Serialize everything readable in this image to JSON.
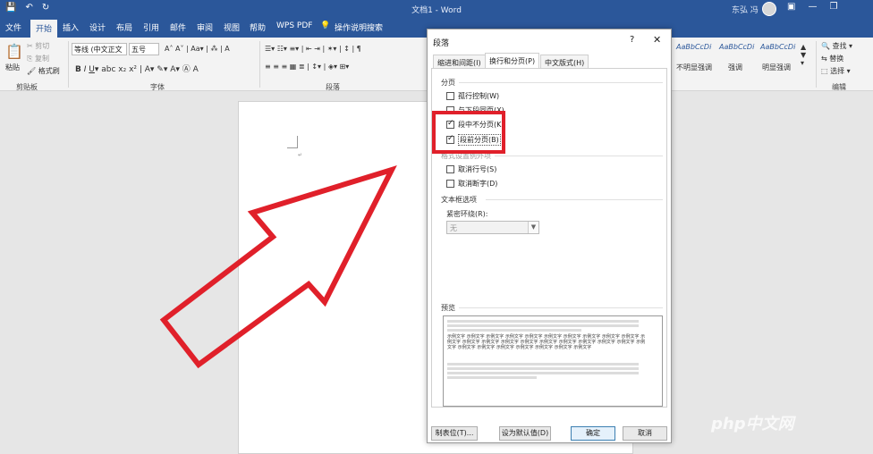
{
  "window": {
    "title": "文档1 - Word",
    "user": "东弘 冯",
    "qat_icons": [
      "save-icon",
      "undo-icon",
      "redo-icon"
    ]
  },
  "menu": {
    "tabs": [
      "文件",
      "开始",
      "插入",
      "设计",
      "布局",
      "引用",
      "邮件",
      "审阅",
      "视图",
      "帮助",
      "WPS PDF"
    ],
    "active": "开始",
    "tell_me": "操作说明搜索"
  },
  "ribbon": {
    "clipboard": {
      "paste": "粘贴",
      "cut": "剪切",
      "copy": "复制",
      "format_painter": "格式刷",
      "label": "剪贴板"
    },
    "font": {
      "font_name": "等线 (中文正文",
      "font_size": "五号",
      "label": "字体"
    },
    "paragraph": {
      "label": "段落"
    },
    "styles": {
      "items": [
        {
          "preview": "AaBbCcDi",
          "name": "不明显强调"
        },
        {
          "preview": "AaBbCcDi",
          "name": "强调"
        },
        {
          "preview": "AaBbCcDi",
          "name": "明显强调"
        }
      ]
    },
    "editing": {
      "find": "查找",
      "replace": "替换",
      "select": "选择",
      "label": "编辑"
    }
  },
  "dialog": {
    "title": "段落",
    "help": "?",
    "tabs": [
      "缩进和间距(I)",
      "换行和分页(P)",
      "中文版式(H)"
    ],
    "active_tab": "换行和分页(P)",
    "pagination": {
      "heading": "分页",
      "options": [
        {
          "label": "孤行控制(W)",
          "checked": false
        },
        {
          "label": "与下段同页(X)",
          "checked": false
        },
        {
          "label": "段中不分页(K)",
          "checked": true
        },
        {
          "label": "段前分页(B)",
          "checked": true
        }
      ]
    },
    "format_exceptions": {
      "heading": "格式设置例外项",
      "options": [
        {
          "label": "取消行号(S)",
          "checked": false
        },
        {
          "label": "取消断字(D)",
          "checked": false
        }
      ]
    },
    "textbox": {
      "heading": "文本框选项",
      "wrap_label": "紧密环绕(R):",
      "wrap_value": "无"
    },
    "preview": {
      "heading": "预览",
      "sample_text": "示例文字"
    },
    "buttons": {
      "tabs": "制表位(T)...",
      "set_default": "设为默认值(D)",
      "ok": "确定",
      "cancel": "取消"
    }
  },
  "watermark": "php中文网",
  "colors": {
    "word_blue": "#2b579a",
    "highlight_red": "#e0202a"
  }
}
